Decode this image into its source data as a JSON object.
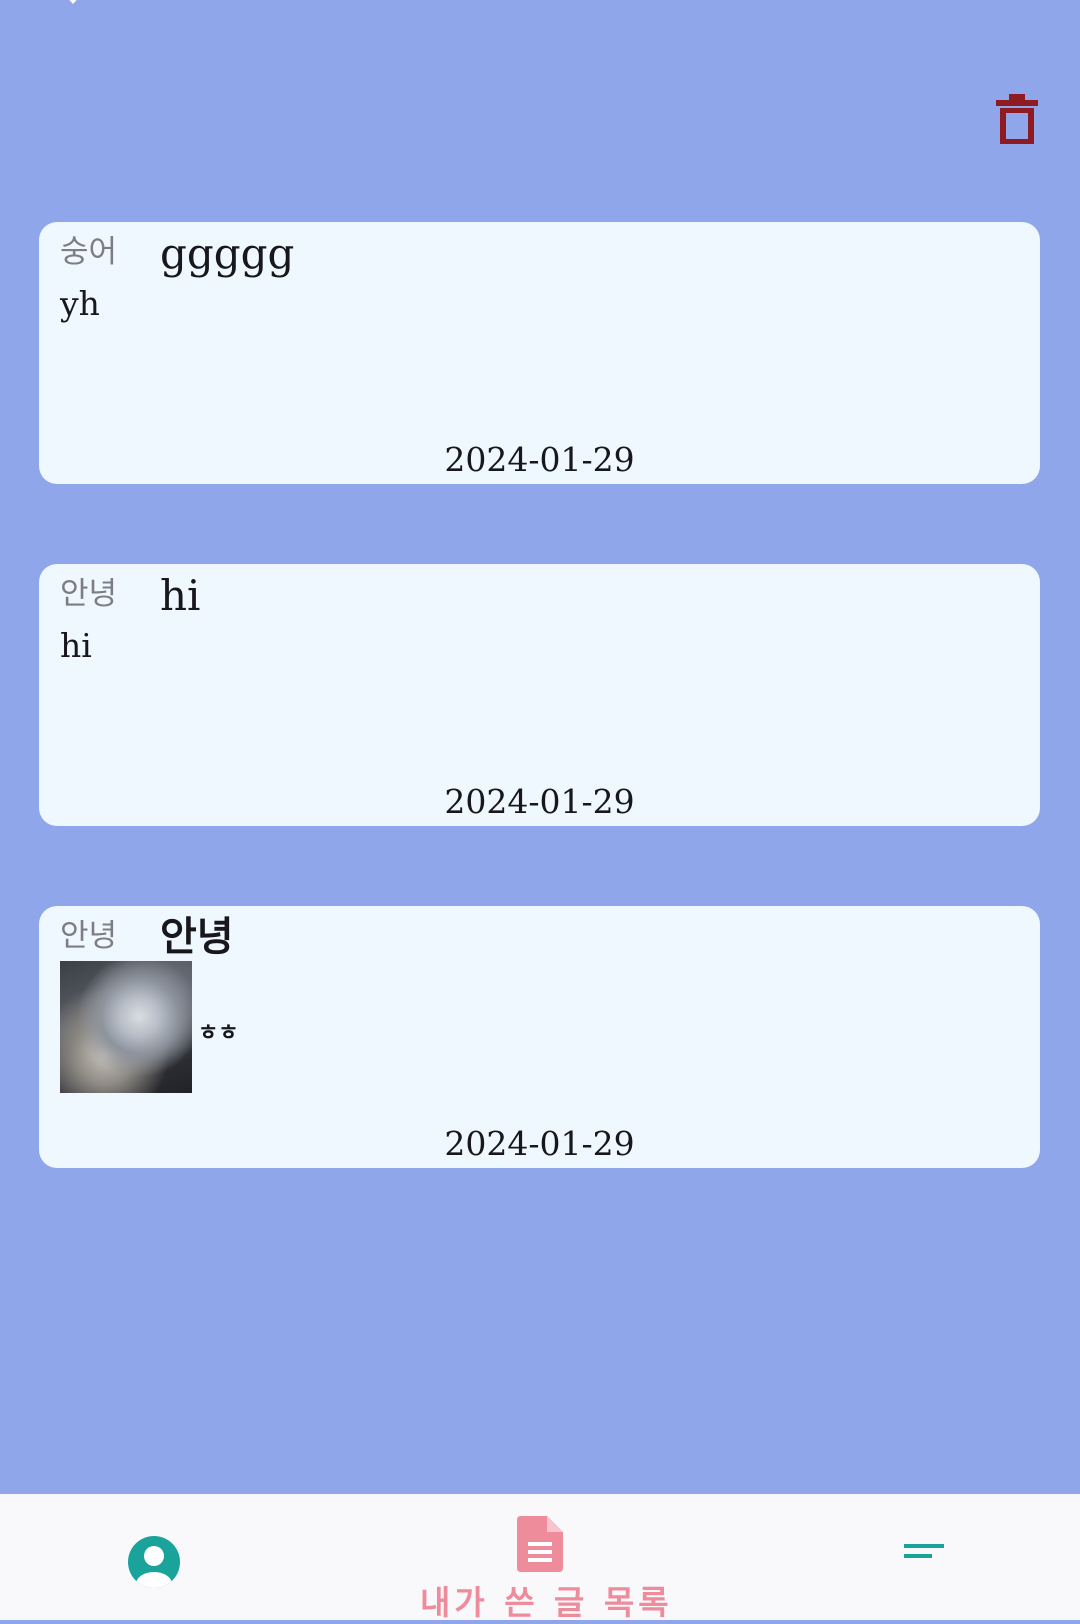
{
  "colors": {
    "background": "#8fa6ea",
    "card": "#eff7ff",
    "delete": "#8e1a22",
    "nav_background": "#f9f9fb",
    "accent_teal": "#1aa39a",
    "accent_pink": "#ee8c9c"
  },
  "toolbar": {
    "delete_icon": "trash-icon"
  },
  "posts": [
    {
      "author": "숭어",
      "title": "ggggg",
      "body": "yh",
      "date": "2024-01-29",
      "has_image": false
    },
    {
      "author": "안녕",
      "title": "hi",
      "body": "hi",
      "date": "2024-01-29",
      "has_image": false
    },
    {
      "author": "안녕",
      "title": "안녕",
      "body": "ㅎㅎ",
      "date": "2024-01-29",
      "has_image": true
    }
  ],
  "bottom_nav": {
    "profile_icon": "profile-icon",
    "posts_icon": "document-icon",
    "posts_label": "내가 쓴 글 목록",
    "menu_icon": "menu-icon"
  }
}
